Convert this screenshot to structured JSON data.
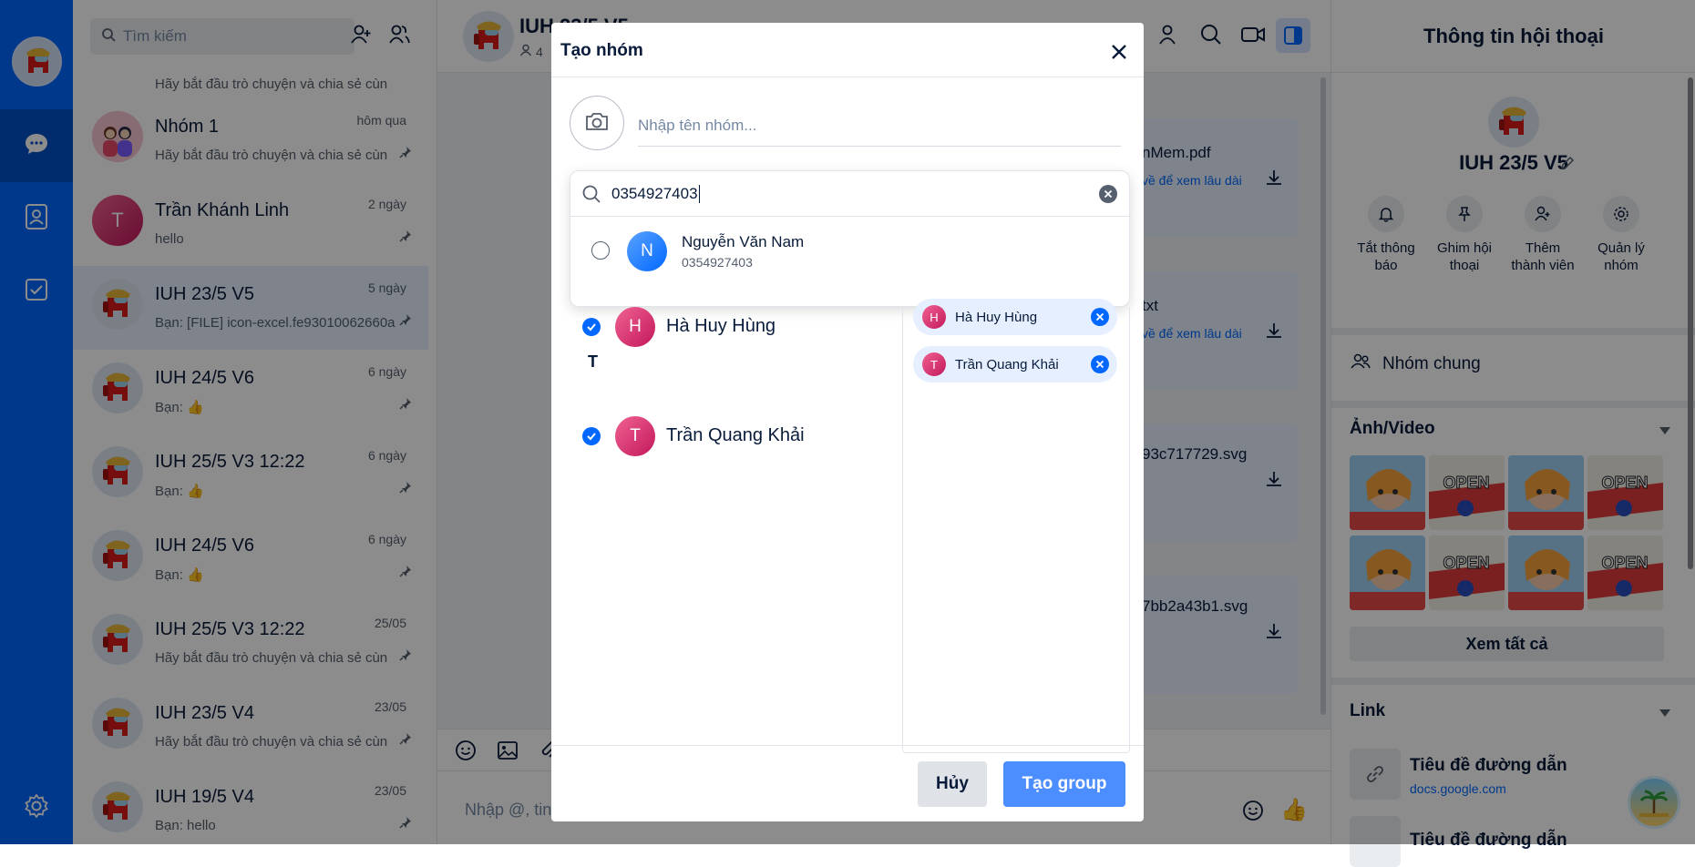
{
  "sidebar": {
    "avatar": "amongus-avatar",
    "items": [
      "chat-icon",
      "contacts-icon",
      "todo-icon",
      "settings-icon"
    ]
  },
  "search": {
    "placeholder": "Tìm kiếm"
  },
  "conversations": [
    {
      "name": "",
      "preview": "Hãy bắt đầu trò chuyện và chia sẻ cùn",
      "time": "",
      "avatar": "amongus"
    },
    {
      "name": "Nhóm 1",
      "preview": "Hãy bắt đầu trò chuyện và chia sẻ cùn",
      "time": "hôm qua",
      "avatar": "group"
    },
    {
      "name": "Trần Khánh Linh",
      "preview": "hello",
      "time": "2 ngày",
      "avatar_letter": "T"
    },
    {
      "name": "IUH 23/5 V5",
      "preview": "Bạn: [FILE] icon-excel.fe93010062660a",
      "time": "5 ngày",
      "avatar": "amongus"
    },
    {
      "name": "IUH 24/5 V6",
      "preview": "Bạn:",
      "time": "6 ngày",
      "avatar": "amongus"
    },
    {
      "name": "IUH 25/5 V3 12:22",
      "preview": "Bạn:",
      "time": "6 ngày",
      "avatar": "amongus"
    },
    {
      "name": "IUH 24/5 V6",
      "preview": "Bạn:",
      "time": "6 ngày",
      "avatar": "amongus"
    },
    {
      "name": "IUH 25/5 V3 12:22",
      "preview": "Hãy bắt đầu trò chuyện và chia sẻ cùn",
      "time": "25/05",
      "avatar": "amongus"
    },
    {
      "name": "IUH 23/5 V4",
      "preview": "Hãy bắt đầu trò chuyện và chia sẻ cùn",
      "time": "23/05",
      "avatar": "amongus"
    },
    {
      "name": "IUH 19/5 V4",
      "preview": "Bạn: hello",
      "time": "23/05",
      "avatar": "amongus"
    }
  ],
  "chat": {
    "title": "IUH 23/5 V5",
    "members": "4",
    "input_placeholder": "Nhập @, tin",
    "files": [
      "nMem.pdf",
      "txt",
      "93c717729.svg",
      "7bb2a43b1.svg"
    ],
    "file_link": "về để xem lâu dài"
  },
  "right_panel": {
    "title": "Thông tin hội thoại",
    "group_name": "IUH 23/5 V5",
    "actions": [
      "Tắt thông báo",
      "Ghim hội thoại",
      "Thêm thành viên",
      "Quản lý nhóm"
    ],
    "common_groups": "Nhóm chung",
    "media_title": "Ảnh/Video",
    "view_all": "Xem tất cả",
    "link_title": "Link",
    "link_item_title": "Tiêu đề đường dẫn",
    "link_item_url": "docs.google.com",
    "link_item_title2": "Tiêu đề đường dẫn"
  },
  "modal": {
    "title": "Tạo nhóm",
    "name_placeholder": "Nhập tên nhóm...",
    "search_value": "0354927403",
    "result": {
      "name": "Nguyễn Văn Nam",
      "phone": "0354927403",
      "letter": "N"
    },
    "section_letter": "T",
    "contacts": [
      {
        "name": "Hà Huy Hùng",
        "letter": "H"
      },
      {
        "name": "Trần Quang Khải",
        "letter": "T"
      }
    ],
    "selected": [
      {
        "name": "Hà Huy Hùng",
        "letter": "H"
      },
      {
        "name": "Trần Quang Khải",
        "letter": "T"
      }
    ],
    "cancel": "Hủy",
    "create": "Tạo group"
  },
  "colors": {
    "brand": "#0068ff",
    "rail": "#0068ff",
    "create_btn": "#4c8dff"
  }
}
